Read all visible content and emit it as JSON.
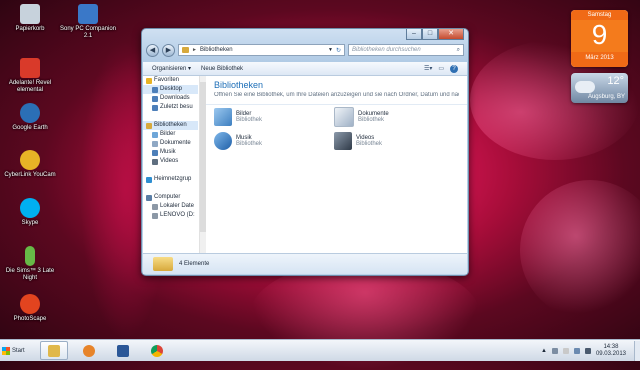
{
  "desktop": {
    "icons": [
      {
        "label": "Papierkorb",
        "icon": "recycle-bin-icon",
        "color": "#c7d2dc"
      },
      {
        "label": "Sony PC Companion 2.1",
        "icon": "sony-pc-companion-icon",
        "color": "#3a78c8"
      },
      {
        "label": "Adelante! Revel elemental",
        "icon": "adelante-icon",
        "color": "#d93a2a"
      },
      {
        "label": "Google Earth",
        "icon": "google-earth-icon",
        "color": "#2b6fb6"
      },
      {
        "label": "CyberLink YouCam",
        "icon": "youcam-icon",
        "color": "#e7b326"
      },
      {
        "label": "Skype",
        "icon": "skype-icon",
        "color": "#00aff0"
      },
      {
        "label": "Die Sims™ 3 Late Night",
        "icon": "sims-icon",
        "color": "#67b947"
      },
      {
        "label": "PhotoScape",
        "icon": "photoscape-icon",
        "color": "#e2441f"
      }
    ]
  },
  "gadgets": {
    "calendar": {
      "weekday": "Samstag",
      "day": "9",
      "month": "März 2013"
    },
    "weather": {
      "temp": "12°",
      "city": "Augsburg, BY"
    }
  },
  "window": {
    "controls": {
      "min": "–",
      "max": "□",
      "close": "✕"
    },
    "address": {
      "path": "Bibliotheken",
      "separator": "►"
    },
    "search_placeholder": "Bibliotheken durchsuchen",
    "toolbar": {
      "organize": "Organisieren ▾",
      "new_library": "Neue Bibliothek"
    },
    "nav": [
      {
        "label": "Favoriten",
        "icon": "star-icon",
        "color": "#e7b326",
        "indent": 0
      },
      {
        "label": "Desktop",
        "icon": "desktop-icon",
        "color": "#4d7fb9",
        "indent": 1,
        "selected": true
      },
      {
        "label": "Downloads",
        "icon": "downloads-icon",
        "color": "#4d7fb9",
        "indent": 1
      },
      {
        "label": "Zuletzt besu",
        "icon": "recent-icon",
        "color": "#4d7fb9",
        "indent": 1
      },
      {
        "label": "",
        "icon": "",
        "color": "",
        "indent": 0
      },
      {
        "label": "Bibliotheken",
        "icon": "libraries-icon",
        "color": "#d7a93c",
        "indent": 0,
        "selected": true
      },
      {
        "label": "Bilder",
        "icon": "pictures-icon",
        "color": "#6ea6d8",
        "indent": 1
      },
      {
        "label": "Dokumente",
        "icon": "documents-icon",
        "color": "#8fa8c4",
        "indent": 1
      },
      {
        "label": "Musik",
        "icon": "music-icon",
        "color": "#4d7fb9",
        "indent": 1
      },
      {
        "label": "Videos",
        "icon": "videos-icon",
        "color": "#5f6f80",
        "indent": 1
      },
      {
        "label": "",
        "icon": "",
        "color": "",
        "indent": 0
      },
      {
        "label": "Heimnetzgrup",
        "icon": "homegroup-icon",
        "color": "#2f8fd1",
        "indent": 0
      },
      {
        "label": "",
        "icon": "",
        "color": "",
        "indent": 0
      },
      {
        "label": "Computer",
        "icon": "computer-icon",
        "color": "#5a7ea6",
        "indent": 0
      },
      {
        "label": "Lokaler Date",
        "icon": "drive-icon",
        "color": "#8c98a6",
        "indent": 1
      },
      {
        "label": "LENOVO (D:",
        "icon": "drive-icon",
        "color": "#8c98a6",
        "indent": 1
      }
    ],
    "content": {
      "title": "Bibliotheken",
      "subtitle": "Öffnen Sie eine Bibliothek, um Ihre Dateien anzuzeigen und sie nach Ordner, Datum und nach ...",
      "libraries": [
        {
          "name": "Bilder",
          "type": "Bibliothek",
          "icon": "pictures-icon",
          "color": "#5d9fd5"
        },
        {
          "name": "Dokumente",
          "type": "Bibliothek",
          "icon": "documents-icon",
          "color": "#b8c7d8"
        },
        {
          "name": "Musik",
          "type": "Bibliothek",
          "icon": "music-icon",
          "color": "#2f78c4"
        },
        {
          "name": "Videos",
          "type": "Bibliothek",
          "icon": "videos-icon",
          "color": "#55657a"
        }
      ]
    },
    "details": {
      "count": "4 Elemente"
    }
  },
  "taskbar": {
    "start": "Start",
    "buttons": [
      {
        "icon": "explorer-icon",
        "color": "#e0b84a",
        "active": true
      },
      {
        "icon": "media-player-icon",
        "color": "#e7842a",
        "active": false
      },
      {
        "icon": "word-icon",
        "color": "#2b5797",
        "active": false
      },
      {
        "icon": "chrome-icon",
        "color": "#4a9a3a",
        "active": false
      }
    ],
    "clock": {
      "time": "14:38",
      "date": "09.03.2013"
    }
  }
}
